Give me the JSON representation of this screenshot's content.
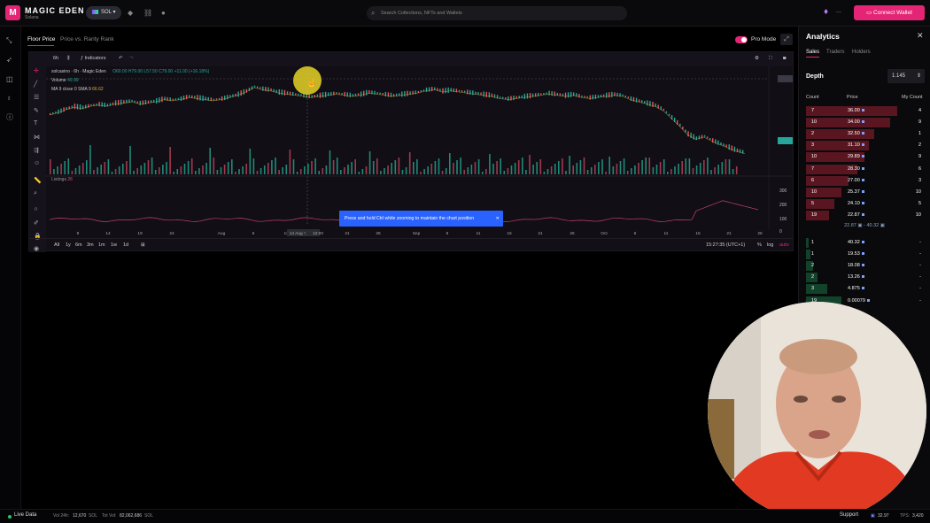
{
  "brand": {
    "name": "MAGIC EDEN",
    "sub": "Solana",
    "logo_letter": "M",
    "accent": "#e42575"
  },
  "topbar": {
    "chain": "SOL",
    "search_placeholder": "Search Collections, NFTs and Wallets",
    "connect_label": "Connect Wallet",
    "more": "..."
  },
  "tabs": [
    {
      "label": "Floor Price"
    },
    {
      "label": "Price vs. Rarity Rank"
    }
  ],
  "pro_mode": {
    "label": "Pro Mode",
    "enabled": true
  },
  "chart_toolbar": {
    "interval": "6h",
    "indicators": "Indicators"
  },
  "chart_data": {
    "type": "line",
    "legend_title": "solcasino · 6h · Magic Eden",
    "ohlc": "O60.00 H79.00 L57.50 C79.00 +11.00 (+16.18%)",
    "volume_label": "Volume",
    "volume_value": "49.99",
    "ma_label": "MA 9 close 0 SMA 9",
    "ma_value": "66.62",
    "listings_label": "Listings",
    "listings_value": "26",
    "price_axis": [
      "84.96",
      "80.00",
      "60.00",
      "40.00",
      "22.89",
      "20.00",
      "0.00"
    ],
    "listing_axis": [
      "300",
      "200",
      "100",
      "0"
    ],
    "x_ticks": [
      "9",
      "14",
      "19",
      "24",
      "Aug",
      "6",
      "11",
      "14 Aug '23",
      "12:00",
      "21",
      "26",
      "Sep",
      "6",
      "11",
      "16",
      "21",
      "26",
      "Oct",
      "6",
      "11",
      "16",
      "21",
      "26"
    ],
    "ylim": [
      0,
      90
    ],
    "series": [
      {
        "values": [
          58,
          60,
          63,
          65,
          64,
          66,
          67,
          66,
          68,
          69,
          70,
          68,
          69,
          70,
          72,
          71,
          72,
          74,
          73,
          72,
          71,
          72,
          74,
          76,
          79,
          83,
          81,
          80,
          78,
          77,
          76,
          75,
          74,
          75,
          76,
          77,
          76,
          75,
          76,
          78,
          77,
          76,
          75,
          76,
          77,
          78,
          80,
          81,
          79,
          80,
          79,
          78,
          77,
          76,
          75,
          73,
          72,
          73,
          74,
          75,
          76,
          77,
          76,
          75,
          76,
          74,
          73,
          74,
          75,
          76,
          75,
          72,
          70,
          68,
          66,
          62,
          55,
          48,
          40,
          36,
          38,
          34,
          31,
          28,
          25,
          23
        ]
      }
    ]
  },
  "tooltip": "Press and hold Ctrl while zooming to maintain the chart position",
  "range_buttons": [
    "All",
    "1y",
    "6m",
    "3m",
    "1m",
    "1w",
    "1d"
  ],
  "range_right": {
    "time": "15:27:35 (UTC+1)",
    "percent": "%",
    "log": "log",
    "auto": "auto"
  },
  "analytics": {
    "title": "Analytics",
    "tabs": [
      "Sales",
      "Traders",
      "Holders"
    ],
    "depth_label": "Depth",
    "depth_value": "1.145",
    "headers": {
      "count": "Count",
      "price": "Price",
      "my_count": "My Count"
    },
    "asks": [
      {
        "count": "7",
        "price": "36.00",
        "my": "4",
        "w": 0.78
      },
      {
        "count": "10",
        "price": "34.00",
        "my": "9",
        "w": 0.72
      },
      {
        "count": "2",
        "price": "32.50",
        "my": "1",
        "w": 0.58
      },
      {
        "count": "3",
        "price": "31.10",
        "my": "2",
        "w": 0.54
      },
      {
        "count": "10",
        "price": "29.89",
        "my": "9",
        "w": 0.5
      },
      {
        "count": "7",
        "price": "28.30",
        "my": "6",
        "w": 0.44
      },
      {
        "count": "6",
        "price": "27.00",
        "my": "3",
        "w": 0.36
      },
      {
        "count": "10",
        "price": "25.37",
        "my": "10",
        "w": 0.3
      },
      {
        "count": "5",
        "price": "24.10",
        "my": "5",
        "w": 0.24
      },
      {
        "count": "19",
        "price": "22.87",
        "my": "10",
        "w": 0.2
      }
    ],
    "spread": "22.87 ▣ - 40.32 ▣",
    "bids": [
      {
        "count": "1",
        "price": "40.32",
        "my": "-",
        "w": 0.02
      },
      {
        "count": "1",
        "price": "19.53",
        "my": "-",
        "w": 0.04
      },
      {
        "count": "2",
        "price": "18.08",
        "my": "-",
        "w": 0.06
      },
      {
        "count": "2",
        "price": "13.26",
        "my": "-",
        "w": 0.1
      },
      {
        "count": "3",
        "price": "4.875",
        "my": "-",
        "w": 0.18
      },
      {
        "count": "19",
        "price": "0.00079",
        "my": "-",
        "w": 0.3
      }
    ]
  },
  "bottombar": {
    "live": "Live Data",
    "vol24": "Vol 24h:",
    "vol24_value": "12,670",
    "totvol": "Tot Vol:",
    "totvol_value": "82,062,686",
    "sol": "SOL",
    "support": "Support",
    "sol_price": "32.97",
    "tps": "TPS:",
    "tps_value": "3,420"
  }
}
